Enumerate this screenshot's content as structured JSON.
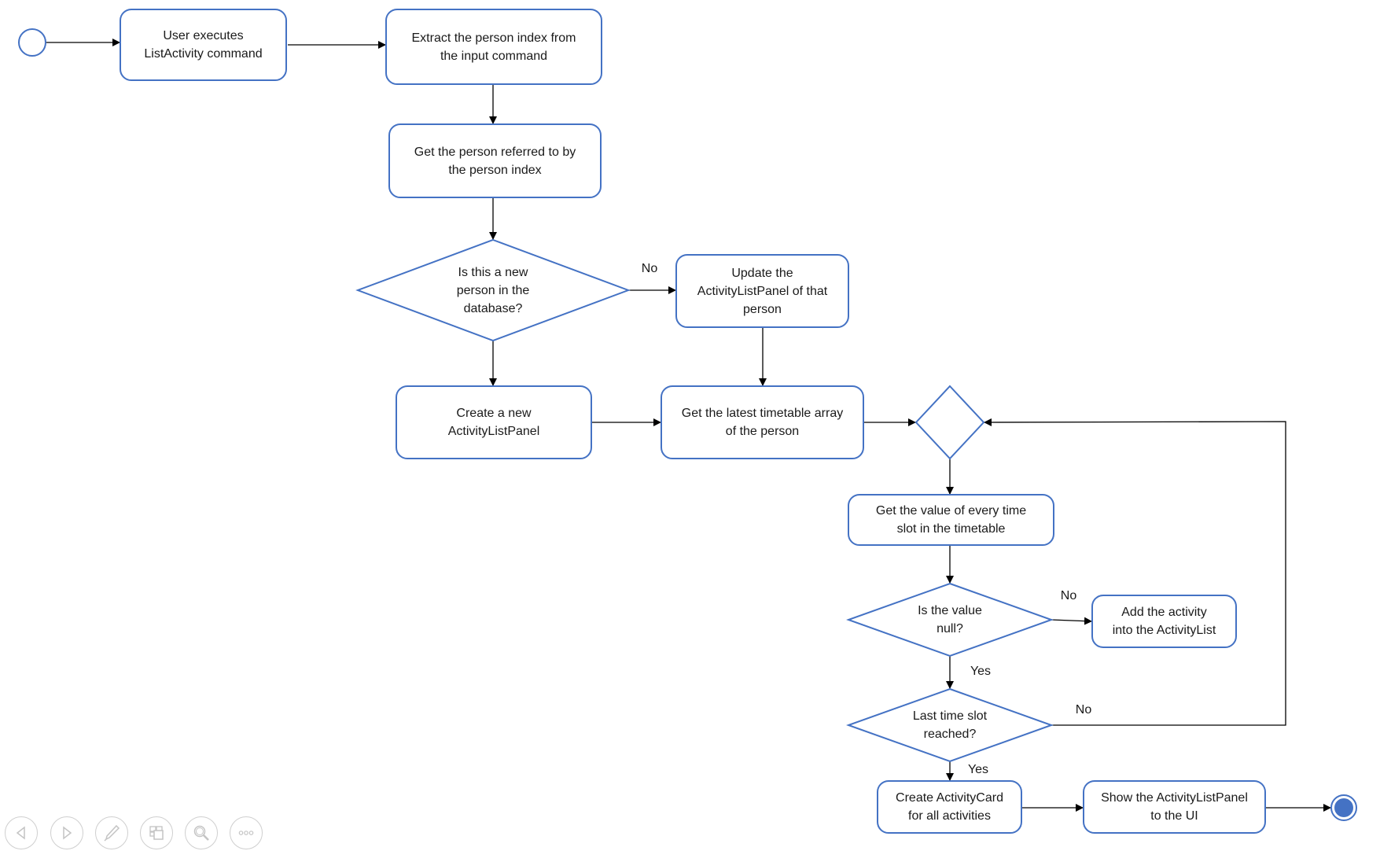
{
  "colors": {
    "shape_stroke": "#4472C4",
    "end_fill": "#4472C4",
    "connector": "#000000",
    "text": "#1a1a1a",
    "toolbar_icon": "#c8c8c8"
  },
  "diagram": {
    "start": {
      "label": "start-node"
    },
    "end": {
      "label": "end-node"
    },
    "nodes": [
      {
        "id": "user-executes",
        "shape": "rounded-rect",
        "text": "User executes\nListActivity command"
      },
      {
        "id": "extract-index",
        "shape": "rounded-rect",
        "text": "Extract the person index from\nthe input command"
      },
      {
        "id": "get-person",
        "shape": "rounded-rect",
        "text": "Get the person referred to by\nthe person index"
      },
      {
        "id": "is-new-person",
        "shape": "diamond",
        "text": "Is this a new\nperson in the\ndatabase?"
      },
      {
        "id": "update-panel",
        "shape": "rounded-rect",
        "text": "Update the\nActivityListPanel of that\nperson"
      },
      {
        "id": "create-panel",
        "shape": "rounded-rect",
        "text": "Create a new\nActivityListPanel"
      },
      {
        "id": "get-timetable",
        "shape": "rounded-rect",
        "text": "Get the latest timetable array\nof the person"
      },
      {
        "id": "merge",
        "shape": "diamond",
        "text": ""
      },
      {
        "id": "get-slot-value",
        "shape": "rounded-rect",
        "text": "Get the value of every time\nslot in the timetable"
      },
      {
        "id": "is-null",
        "shape": "diamond",
        "text": "Is the value\nnull?"
      },
      {
        "id": "add-activity",
        "shape": "rounded-rect",
        "text": "Add the activity\ninto the ActivityList"
      },
      {
        "id": "last-slot",
        "shape": "diamond",
        "text": "Last time slot\nreached?"
      },
      {
        "id": "create-cards",
        "shape": "rounded-rect",
        "text": "Create ActivityCard\nfor all activities"
      },
      {
        "id": "show-panel",
        "shape": "rounded-rect",
        "text": "Show the ActivityListPanel\nto the UI"
      }
    ],
    "edges": [
      {
        "from": "start",
        "to": "user-executes",
        "label": ""
      },
      {
        "from": "user-executes",
        "to": "extract-index",
        "label": ""
      },
      {
        "from": "extract-index",
        "to": "get-person",
        "label": ""
      },
      {
        "from": "get-person",
        "to": "is-new-person",
        "label": ""
      },
      {
        "from": "is-new-person",
        "to": "update-panel",
        "label": "No"
      },
      {
        "from": "is-new-person",
        "to": "create-panel",
        "label": ""
      },
      {
        "from": "update-panel",
        "to": "get-timetable",
        "label": ""
      },
      {
        "from": "create-panel",
        "to": "get-timetable",
        "label": ""
      },
      {
        "from": "get-timetable",
        "to": "merge",
        "label": ""
      },
      {
        "from": "merge",
        "to": "get-slot-value",
        "label": ""
      },
      {
        "from": "get-slot-value",
        "to": "is-null",
        "label": ""
      },
      {
        "from": "is-null",
        "to": "add-activity",
        "label": "No"
      },
      {
        "from": "is-null",
        "to": "last-slot",
        "label": "Yes"
      },
      {
        "from": "last-slot",
        "to": "merge",
        "label": "No"
      },
      {
        "from": "last-slot",
        "to": "create-cards",
        "label": "Yes"
      },
      {
        "from": "create-cards",
        "to": "show-panel",
        "label": ""
      },
      {
        "from": "show-panel",
        "to": "end",
        "label": ""
      }
    ]
  },
  "toolbar": {
    "buttons": [
      {
        "id": "previous",
        "icon": "triangle-left-icon",
        "label": "Previous"
      },
      {
        "id": "next",
        "icon": "triangle-right-icon",
        "label": "Next"
      },
      {
        "id": "pen",
        "icon": "pen-icon",
        "label": "Pen"
      },
      {
        "id": "slides",
        "icon": "slides-icon",
        "label": "See all slides"
      },
      {
        "id": "zoom",
        "icon": "magnifier-icon",
        "label": "Zoom"
      },
      {
        "id": "more",
        "icon": "more-options-icon",
        "label": "More options"
      }
    ]
  }
}
